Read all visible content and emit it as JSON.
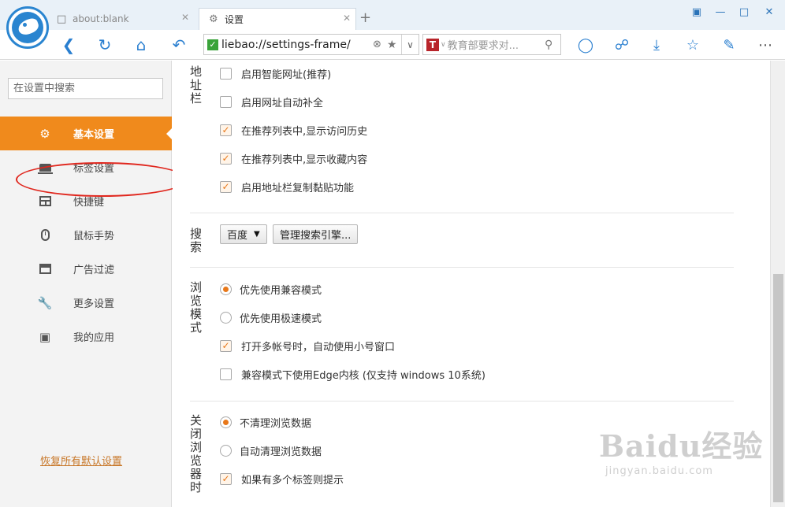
{
  "window": {
    "tabs": [
      {
        "label": "about:blank",
        "active": false
      },
      {
        "label": "设置",
        "active": true
      }
    ],
    "new_tab": "+"
  },
  "addressbar": {
    "url": "liebao://settings-frame/",
    "search_placeholder": "教育部要求对..."
  },
  "sidebar": {
    "search_placeholder": "在设置中搜索",
    "items": [
      {
        "label": "基本设置",
        "icon": "gear-icon",
        "active": true
      },
      {
        "label": "标签设置",
        "icon": "laptop-icon",
        "active": false
      },
      {
        "label": "快捷键",
        "icon": "keyboard-icon",
        "active": false
      },
      {
        "label": "鼠标手势",
        "icon": "mouse-icon",
        "active": false
      },
      {
        "label": "广告过滤",
        "icon": "window-icon",
        "active": false
      },
      {
        "label": "更多设置",
        "icon": "wrench-icon",
        "active": false
      },
      {
        "label": "我的应用",
        "icon": "puzzle-icon",
        "active": false
      }
    ],
    "restore_defaults": "恢复所有默认设置"
  },
  "settings": {
    "address_bar": {
      "title": "地址栏",
      "options": [
        {
          "label": "启用智能网址(推荐)",
          "checked": false
        },
        {
          "label": "启用网址自动补全",
          "checked": false
        },
        {
          "label": "在推荐列表中,显示访问历史",
          "checked": true
        },
        {
          "label": "在推荐列表中,显示收藏内容",
          "checked": true
        },
        {
          "label": "启用地址栏复制黏贴功能",
          "checked": true
        }
      ]
    },
    "search": {
      "title": "搜索",
      "engine": "百度",
      "manage_button": "管理搜索引擎..."
    },
    "browse_mode": {
      "title": "浏览模式",
      "radios": [
        {
          "label": "优先使用兼容模式",
          "selected": true
        },
        {
          "label": "优先使用极速模式",
          "selected": false
        }
      ],
      "checks": [
        {
          "label": "打开多帐号时，自动使用小号窗口",
          "checked": true
        },
        {
          "label": "兼容模式下使用Edge内核 (仅支持 windows 10系统)",
          "checked": false
        }
      ]
    },
    "on_close": {
      "title": "关闭浏览器时",
      "radios": [
        {
          "label": "不清理浏览数据",
          "selected": true
        },
        {
          "label": "自动清理浏览数据",
          "selected": false
        }
      ],
      "checks": [
        {
          "label": "如果有多个标签则提示",
          "checked": true
        }
      ]
    }
  },
  "watermark": {
    "brand": "Baidu经验",
    "url": "jingyan.baidu.com"
  },
  "colors": {
    "accent": "#f08a1c",
    "link": "#c8782a",
    "annotation": "#e0271e",
    "nav_icon": "#2a7fd0"
  }
}
